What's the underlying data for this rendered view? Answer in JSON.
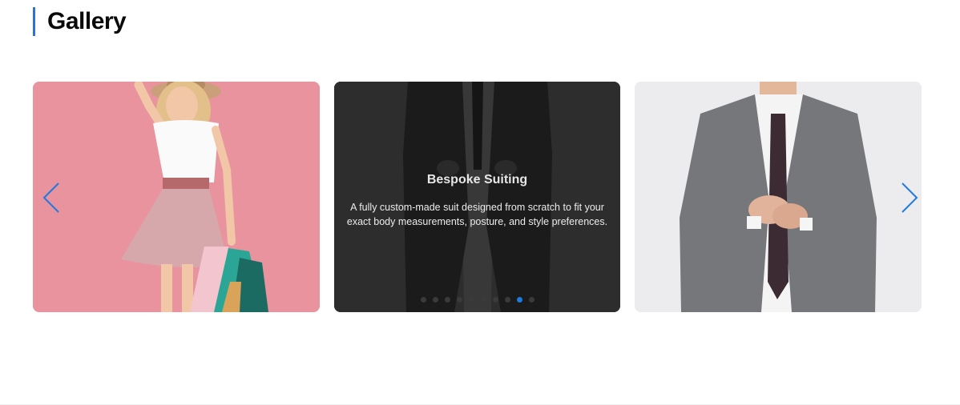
{
  "page": {
    "title": "Gallery"
  },
  "carousel": {
    "slides": [
      {
        "alt": "Girl with shopping bags"
      },
      {
        "title": "Bespoke Suiting",
        "description": "A fully custom-made suit designed from scratch to fit your exact body measurements, posture, and style preferences."
      },
      {
        "alt": "Man in grey suit"
      }
    ],
    "prev_icon": "chevron-left-icon",
    "next_icon": "chevron-right-icon",
    "dots_count": 10,
    "active_dot": 9
  },
  "colors": {
    "accent": "#2f6fdc",
    "arrow": "#1f7ae0"
  }
}
